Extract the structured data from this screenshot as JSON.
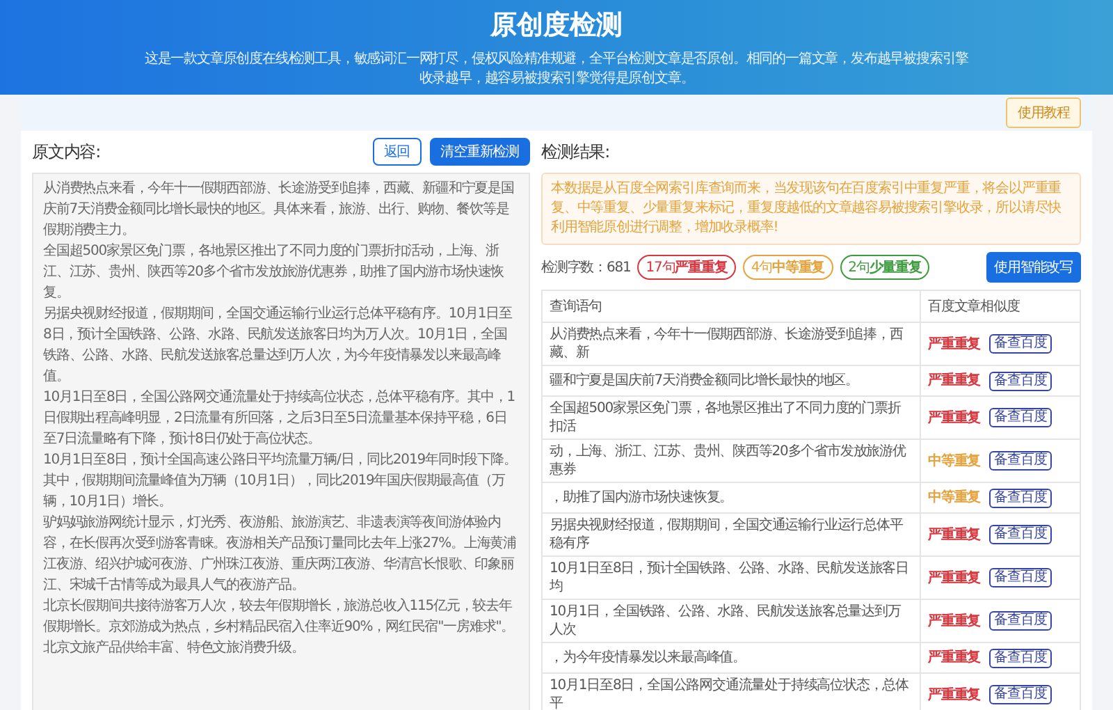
{
  "header": {
    "title": "原创度检测",
    "description": "这是一款文章原创度在线检测工具，敏感词汇一网打尽，侵权风险精准规避，全平台检测文章是否原创。相同的一篇文章，发布越早被搜索引擎收录越早，越容易被搜索引擎觉得是原创文章。"
  },
  "toolbar": {
    "tutorial_button": "使用教程"
  },
  "original": {
    "heading": "原文内容:",
    "back_button": "返回",
    "clear_button": "清空重新检测",
    "paragraphs": [
      "从消费热点来看，今年十一假期西部游、长途游受到追捧，西藏、新疆和宁夏是国庆前7天消费金额同比增长最快的地区。具体来看，旅游、出行、购物、餐饮等是假期消费主力。",
      "全国超500家景区免门票，各地景区推出了不同力度的门票折扣活动，上海、浙江、江苏、贵州、陕西等20多个省市发放旅游优惠券，助推了国内游市场快速恢复。",
      "另据央视财经报道，假期期间，全国交通运输行业运行总体平稳有序。10月1日至8日，预计全国铁路、公路、水路、民航发送旅客日均为万人次。10月1日，全国铁路、公路、水路、民航发送旅客总量达到万人次，为今年疫情暴发以来最高峰值。",
      "10月1日至8日，全国公路网交通流量处于持续高位状态，总体平稳有序。其中，1日假期出程高峰明显，2日流量有所回落，之后3日至5日流量基本保持平稳，6日至7日流量略有下降，预计8日仍处于高位状态。",
      "10月1日至8日，预计全国高速公路日平均流量万辆/日，同比2019年同时段下降。",
      "其中，假期期间流量峰值为万辆（10月1日），同比2019年国庆假期最高值（万辆，10月1日）增长。",
      "驴妈妈旅游网统计显示，灯光秀、夜游船、旅游演艺、非遗表演等夜间游体验内容，在长假再次受到游客青睐。夜游相关产品预订量同比去年上涨27%。上海黄浦江夜游、绍兴护城河夜游、广州珠江夜游、重庆两江夜游、华清宫长恨歌、印象丽江、宋城千古情等成为最具人气的夜游产品。",
      "北京长假期间共接待游客万人次，较去年假期增长，旅游总收入115亿元，较去年假期增长。京郊游成为热点，乡村精品民宿入住率近90%，网红民宿\"一房难求\"。北京文旅产品供给丰富、特色文旅消费升级。"
    ]
  },
  "result": {
    "heading": "检测结果:",
    "notice": "本数据是从百度全网索引库查询而来，当发现该句在百度索引中重复严重，将会以严重重复、中等重复、少量重复来标记，重复度越低的文章越容易被搜索引擎收录，所以请尽快利用智能原创进行调整，增加收录概率!",
    "word_count": "检测字数：681",
    "tags": [
      {
        "text": "17句**严重重复**",
        "color": "#d9363e"
      },
      {
        "text": "4句**中等重复**",
        "color": "#e6a23c"
      },
      {
        "text": "2句**少量重复**",
        "color": "#3f9b3f"
      }
    ],
    "rewrite_button": "使用智能改写",
    "table": {
      "columns": [
        "查询语句",
        "百度文章相似度"
      ],
      "rows": [
        {
          "sentence": "从消费热点来看，今年十一假期西部游、长途游受到追捧，西藏、新",
          "kind": "severe",
          "similarity": "严重重复",
          "action": "备查百度"
        },
        {
          "sentence": "疆和宁夏是国庆前7天消费金额同比增长最快的地区。",
          "kind": "severe",
          "similarity": "严重重复",
          "action": "备查百度"
        },
        {
          "sentence": "全国超500家景区免门票，各地景区推出了不同力度的门票折扣活",
          "kind": "severe",
          "similarity": "严重重复",
          "action": "备查百度"
        },
        {
          "sentence": "动，上海、浙江、江苏、贵州、陕西等20多个省市发放旅游优惠券",
          "kind": "moderate",
          "similarity": "中等重复",
          "action": "备查百度"
        },
        {
          "sentence": "，助推了国内游市场快速恢复。",
          "kind": "moderate",
          "similarity": "中等重复",
          "action": "备查百度"
        },
        {
          "sentence": "另据央视财经报道，假期期间，全国交通运输行业运行总体平稳有序",
          "kind": "severe",
          "similarity": "严重重复",
          "action": "备查百度"
        },
        {
          "sentence": "10月1日至8日，预计全国铁路、公路、水路、民航发送旅客日均",
          "kind": "severe",
          "similarity": "严重重复",
          "action": "备查百度"
        },
        {
          "sentence": "10月1日，全国铁路、公路、水路、民航发送旅客总量达到万人次",
          "kind": "severe",
          "similarity": "严重重复",
          "action": "备查百度"
        },
        {
          "sentence": "，为今年疫情暴发以来最高峰值。",
          "kind": "severe",
          "similarity": "严重重复",
          "action": "备查百度"
        },
        {
          "sentence": "10月1日至8日，全国公路网交通流量处于持续高位状态，总体平",
          "kind": "severe",
          "similarity": "严重重复",
          "action": "备查百度"
        }
      ]
    }
  }
}
